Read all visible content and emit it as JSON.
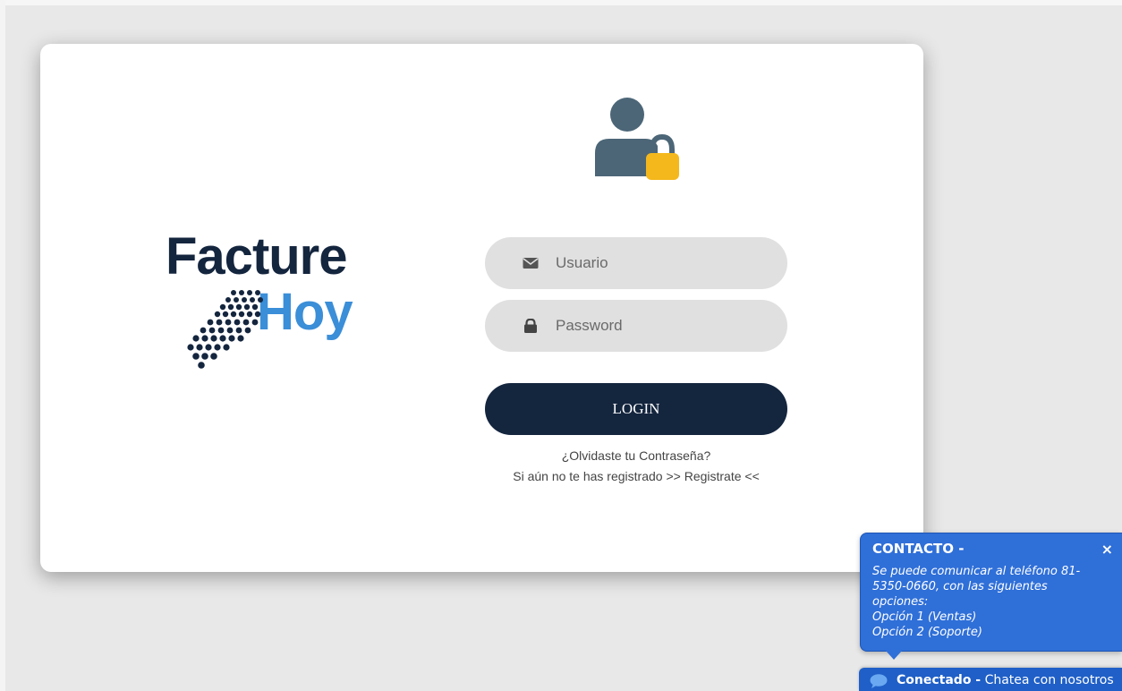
{
  "logo": {
    "line1": "Facture",
    "line2": "Hoy"
  },
  "form": {
    "username_placeholder": "Usuario",
    "username_value": "",
    "password_placeholder": "Password",
    "password_value": "",
    "login_label": "LOGIN",
    "forgot_label": "¿Olvidaste tu Contraseña?",
    "register_prefix": "Si aún no te has registrado ",
    "register_link": ">> Registrate <<"
  },
  "chat": {
    "title": "CONTACTO -",
    "close_label": "×",
    "message_lines": [
      "Se puede comunicar al teléfono 81-",
      "5350-0660, con las siguientes",
      "opciones:",
      "Opción 1 (Ventas)",
      "Opción 2 (Soporte)"
    ],
    "status_label": "Conectado -",
    "status_cta": " Chatea con nosotros"
  },
  "icons": {
    "user": "user-lock-icon",
    "username_field": "envelope-icon",
    "password_field": "lock-icon",
    "chat": "chat-bubble-icon"
  },
  "colors": {
    "brand_dark": "#14253e",
    "brand_blue": "#3b8ed8",
    "lock_yellow": "#f4b81c",
    "user_gray": "#4c6677",
    "chat_blue": "#2f6fd8"
  }
}
